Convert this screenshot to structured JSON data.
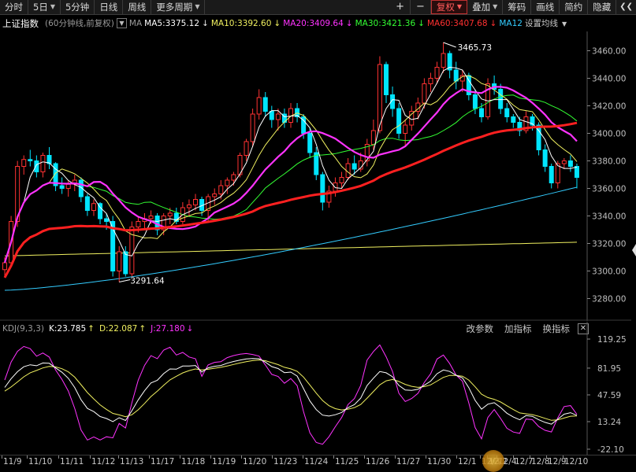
{
  "toolbar": {
    "timeshare": "分时",
    "days": "5日",
    "min5": "5分钟",
    "daily": "日线",
    "weekly": "周线",
    "more": "更多周期",
    "adjust": "复权",
    "overlay": "叠加",
    "chips": "筹码",
    "draw": "画线",
    "simple": "简约",
    "hide": "隐藏"
  },
  "info": {
    "name": "上证指数",
    "period": "(60分钟线,前复权)",
    "ma_label": "MA",
    "ma5": "MA5:3375.12",
    "ma5_arrow": "↓",
    "ma10": "MA10:3392.60",
    "ma10_arrow": "↓",
    "ma20": "MA20:3409.64",
    "ma20_arrow": "↓",
    "ma30": "MA30:3421.36",
    "ma30_arrow": "↓",
    "ma60": "MA60:3407.68",
    "ma60_arrow": "↓",
    "ma120": "MA12",
    "settings": "设置均线"
  },
  "kdj": {
    "label": "KDJ(9,3,3)",
    "k": "K:23.785",
    "k_arrow": "↑",
    "d": "D:22.087",
    "d_arrow": "↑",
    "j": "J:27.180",
    "j_arrow": "↓",
    "modify": "改参数",
    "add": "加指标",
    "switch": "换指标"
  },
  "colors": {
    "up": "#ff3232",
    "down": "#00e5ff",
    "ma5": "#ffffff",
    "ma10": "#f0f060",
    "ma20": "#ff33ff",
    "ma30": "#33ff33",
    "ma60": "#ff2020",
    "ma120": "#33ccff",
    "ma250": "#f0f060"
  },
  "price_axis": {
    "ticks": [
      "3460.00",
      "3440.00",
      "3420.00",
      "3400.00",
      "3380.00",
      "3360.00",
      "3340.00",
      "3320.00",
      "3300.00",
      "3280.00"
    ]
  },
  "kdj_axis": {
    "ticks": [
      "119.25",
      "81.95",
      "47.59",
      "13.24",
      "-22.10"
    ]
  },
  "annotations": {
    "high": "3465.73",
    "low": "3291.64"
  },
  "date_labels": [
    "11/9",
    "11/10",
    "11/11",
    "11/12",
    "11/13",
    "11/17",
    "11/18",
    "11/19",
    "11/20",
    "11/23",
    "11/24",
    "11/25",
    "11/26",
    "11/27",
    "11/30",
    "12/1",
    "12/2",
    "12/3",
    "12/4",
    "12/7",
    "12/8",
    "12/9",
    "12/10"
  ],
  "chart_data": {
    "type": "candlestick",
    "title": "",
    "ylim": [
      3270,
      3470
    ],
    "kdj_ylim": [
      -22.1,
      119.25
    ],
    "candles": [
      [
        3301,
        3310,
        3296,
        3306
      ],
      [
        3306,
        3340,
        3303,
        3336
      ],
      [
        3336,
        3380,
        3332,
        3376
      ],
      [
        3376,
        3384,
        3370,
        3381
      ],
      [
        3381,
        3388,
        3376,
        3380
      ],
      [
        3380,
        3384,
        3368,
        3372
      ],
      [
        3372,
        3386,
        3368,
        3384
      ],
      [
        3384,
        3390,
        3374,
        3378
      ],
      [
        3378,
        3379,
        3358,
        3362
      ],
      [
        3362,
        3368,
        3356,
        3360
      ],
      [
        3360,
        3366,
        3354,
        3363
      ],
      [
        3363,
        3370,
        3358,
        3366
      ],
      [
        3366,
        3368,
        3350,
        3354
      ],
      [
        3354,
        3356,
        3340,
        3344
      ],
      [
        3344,
        3352,
        3340,
        3349
      ],
      [
        3349,
        3350,
        3334,
        3338
      ],
      [
        3338,
        3342,
        3330,
        3336
      ],
      [
        3336,
        3340,
        3296,
        3300
      ],
      [
        3300,
        3318,
        3292,
        3314
      ],
      [
        3314,
        3318,
        3296,
        3298
      ],
      [
        3298,
        3336,
        3296,
        3332
      ],
      [
        3332,
        3340,
        3328,
        3336
      ],
      [
        3336,
        3342,
        3330,
        3338
      ],
      [
        3338,
        3344,
        3334,
        3340
      ],
      [
        3340,
        3342,
        3326,
        3330
      ],
      [
        3330,
        3342,
        3326,
        3340
      ],
      [
        3340,
        3346,
        3334,
        3342
      ],
      [
        3342,
        3346,
        3334,
        3336
      ],
      [
        3336,
        3350,
        3334,
        3346
      ],
      [
        3346,
        3352,
        3340,
        3348
      ],
      [
        3348,
        3356,
        3344,
        3352
      ],
      [
        3352,
        3354,
        3340,
        3344
      ],
      [
        3344,
        3356,
        3336,
        3354
      ],
      [
        3354,
        3360,
        3348,
        3356
      ],
      [
        3356,
        3366,
        3352,
        3362
      ],
      [
        3362,
        3368,
        3356,
        3366
      ],
      [
        3366,
        3372,
        3362,
        3370
      ],
      [
        3370,
        3386,
        3368,
        3384
      ],
      [
        3384,
        3396,
        3380,
        3394
      ],
      [
        3394,
        3418,
        3390,
        3414
      ],
      [
        3414,
        3432,
        3410,
        3426
      ],
      [
        3426,
        3430,
        3412,
        3416
      ],
      [
        3416,
        3420,
        3404,
        3410
      ],
      [
        3410,
        3418,
        3402,
        3414
      ],
      [
        3414,
        3418,
        3404,
        3408
      ],
      [
        3408,
        3422,
        3404,
        3418
      ],
      [
        3418,
        3422,
        3408,
        3412
      ],
      [
        3412,
        3414,
        3396,
        3400
      ],
      [
        3400,
        3404,
        3382,
        3386
      ],
      [
        3386,
        3390,
        3366,
        3370
      ],
      [
        3370,
        3372,
        3344,
        3350
      ],
      [
        3350,
        3362,
        3346,
        3358
      ],
      [
        3358,
        3368,
        3354,
        3364
      ],
      [
        3364,
        3372,
        3360,
        3368
      ],
      [
        3368,
        3382,
        3366,
        3378
      ],
      [
        3378,
        3384,
        3370,
        3374
      ],
      [
        3374,
        3386,
        3372,
        3380
      ],
      [
        3380,
        3396,
        3376,
        3392
      ],
      [
        3392,
        3410,
        3388,
        3402
      ],
      [
        3402,
        3456,
        3400,
        3450
      ],
      [
        3450,
        3452,
        3422,
        3428
      ],
      [
        3428,
        3434,
        3412,
        3418
      ],
      [
        3418,
        3422,
        3396,
        3400
      ],
      [
        3400,
        3410,
        3390,
        3406
      ],
      [
        3406,
        3420,
        3402,
        3416
      ],
      [
        3416,
        3426,
        3410,
        3422
      ],
      [
        3422,
        3440,
        3418,
        3436
      ],
      [
        3436,
        3444,
        3430,
        3440
      ],
      [
        3440,
        3452,
        3436,
        3448
      ],
      [
        3448,
        3466,
        3444,
        3458
      ],
      [
        3458,
        3460,
        3440,
        3446
      ],
      [
        3446,
        3452,
        3432,
        3438
      ],
      [
        3438,
        3446,
        3430,
        3442
      ],
      [
        3442,
        3444,
        3424,
        3428
      ],
      [
        3428,
        3432,
        3414,
        3418
      ],
      [
        3418,
        3422,
        3408,
        3412
      ],
      [
        3412,
        3440,
        3410,
        3436
      ],
      [
        3436,
        3442,
        3428,
        3432
      ],
      [
        3432,
        3436,
        3414,
        3418
      ],
      [
        3418,
        3422,
        3408,
        3412
      ],
      [
        3412,
        3414,
        3404,
        3408
      ],
      [
        3408,
        3412,
        3398,
        3402
      ],
      [
        3402,
        3416,
        3400,
        3412
      ],
      [
        3412,
        3414,
        3402,
        3406
      ],
      [
        3406,
        3408,
        3384,
        3388
      ],
      [
        3388,
        3392,
        3372,
        3376
      ],
      [
        3376,
        3378,
        3360,
        3364
      ],
      [
        3364,
        3380,
        3360,
        3378
      ],
      [
        3378,
        3382,
        3374,
        3380
      ],
      [
        3380,
        3384,
        3372,
        3376
      ],
      [
        3376,
        3378,
        3360,
        3368
      ]
    ],
    "ma_labels": [
      "MA5",
      "MA10",
      "MA20",
      "MA30",
      "MA60",
      "MA120",
      "MA250"
    ]
  }
}
